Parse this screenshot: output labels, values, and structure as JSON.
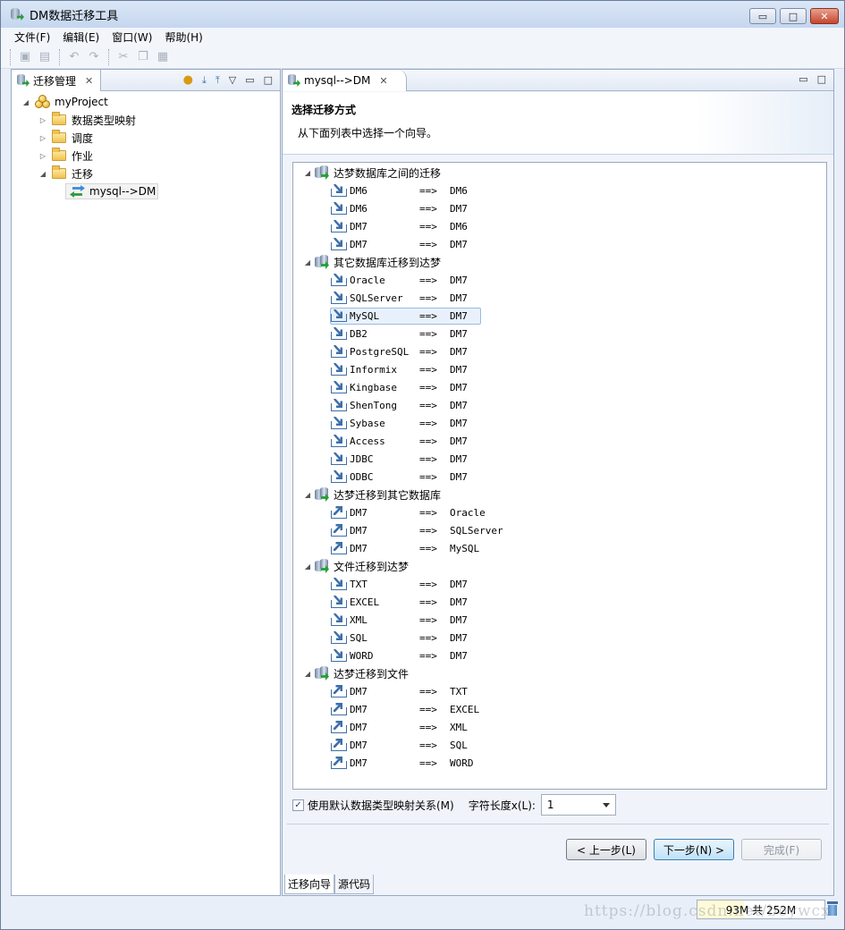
{
  "window": {
    "title": "DM数据迁移工具",
    "buttons": {
      "minimize": "▭",
      "maximize": "□",
      "close": "✕"
    }
  },
  "menu": [
    "文件(F)",
    "编辑(E)",
    "窗口(W)",
    "帮助(H)"
  ],
  "left_panel": {
    "tab_label": "迁移管理",
    "close_glyph": "✕",
    "tree": {
      "project": "myProject",
      "children": [
        "数据类型映射",
        "调度",
        "作业",
        "迁移"
      ],
      "migration_item": "mysql-->DM"
    }
  },
  "editor": {
    "tab_label": "mysql-->DM",
    "close_glyph": "✕",
    "wizard_title": "选择迁移方式",
    "wizard_subtitle": "从下面列表中选择一个向导。",
    "arrow": "==>",
    "groups": [
      {
        "label": "达梦数据库之间的迁移",
        "dir": "in",
        "items": [
          [
            "DM6",
            "DM6"
          ],
          [
            "DM6",
            "DM7"
          ],
          [
            "DM7",
            "DM6"
          ],
          [
            "DM7",
            "DM7"
          ]
        ]
      },
      {
        "label": "其它数据库迁移到达梦",
        "dir": "in",
        "items": [
          [
            "Oracle",
            "DM7"
          ],
          [
            "SQLServer",
            "DM7"
          ],
          [
            "MySQL",
            "DM7"
          ],
          [
            "DB2",
            "DM7"
          ],
          [
            "PostgreSQL",
            "DM7"
          ],
          [
            "Informix",
            "DM7"
          ],
          [
            "Kingbase",
            "DM7"
          ],
          [
            "ShenTong",
            "DM7"
          ],
          [
            "Sybase",
            "DM7"
          ],
          [
            "Access",
            "DM7"
          ],
          [
            "JDBC",
            "DM7"
          ],
          [
            "ODBC",
            "DM7"
          ]
        ]
      },
      {
        "label": "达梦迁移到其它数据库",
        "dir": "out",
        "items": [
          [
            "DM7",
            "Oracle"
          ],
          [
            "DM7",
            "SQLServer"
          ],
          [
            "DM7",
            "MySQL"
          ]
        ]
      },
      {
        "label": "文件迁移到达梦",
        "dir": "in",
        "items": [
          [
            "TXT",
            "DM7"
          ],
          [
            "EXCEL",
            "DM7"
          ],
          [
            "XML",
            "DM7"
          ],
          [
            "SQL",
            "DM7"
          ],
          [
            "WORD",
            "DM7"
          ]
        ]
      },
      {
        "label": "达梦迁移到文件",
        "dir": "out",
        "items": [
          [
            "DM7",
            "TXT"
          ],
          [
            "DM7",
            "EXCEL"
          ],
          [
            "DM7",
            "XML"
          ],
          [
            "DM7",
            "SQL"
          ],
          [
            "DM7",
            "WORD"
          ]
        ]
      }
    ],
    "selected": "MySQL",
    "options": {
      "checkbox_label": "使用默认数据类型映射关系(M)",
      "checkbox_checked": true,
      "char_length_label": "字符长度x(L):",
      "char_length_value": "1"
    },
    "buttons": {
      "back": "< 上一步(L)",
      "next": "下一步(N) >",
      "finish": "完成(F)"
    },
    "bottom_tabs": [
      "迁移向导",
      "源代码"
    ]
  },
  "status": {
    "heap": "93M 共 252M"
  },
  "watermark": "https://blog.csdn.net/boywcx"
}
